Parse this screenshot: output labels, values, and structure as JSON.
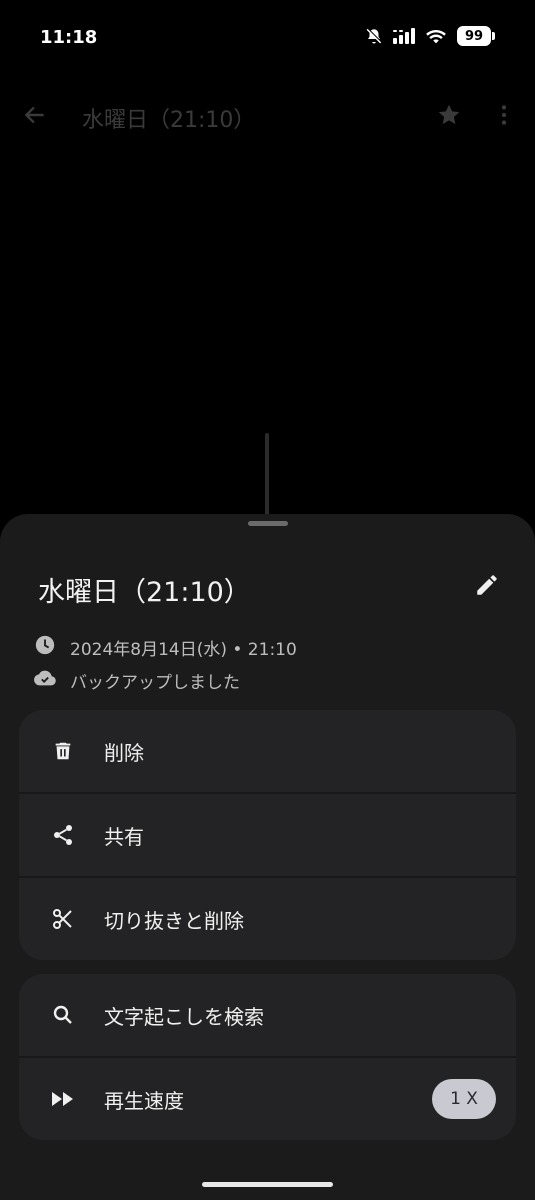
{
  "status_bar": {
    "time": "11:18",
    "battery": "99"
  },
  "app_bar": {
    "title": "水曜日（21:10）"
  },
  "sheet": {
    "title": "水曜日（21:10）",
    "date": "2024年8月14日(水) • 21:10",
    "backup_status": "バックアップしました",
    "actions": [
      {
        "label": "削除",
        "icon": "trash-icon"
      },
      {
        "label": "共有",
        "icon": "share-icon"
      },
      {
        "label": "切り抜きと削除",
        "icon": "scissors-icon"
      }
    ],
    "actions2": [
      {
        "label": "文字起こしを検索",
        "icon": "search-icon"
      },
      {
        "label": "再生速度",
        "icon": "fast-forward-icon",
        "value": "1 X"
      }
    ]
  },
  "colors": {
    "background": "#000000",
    "sheet": "#1b1b1c",
    "card": "#232325",
    "chip": "#c9c9d1"
  }
}
